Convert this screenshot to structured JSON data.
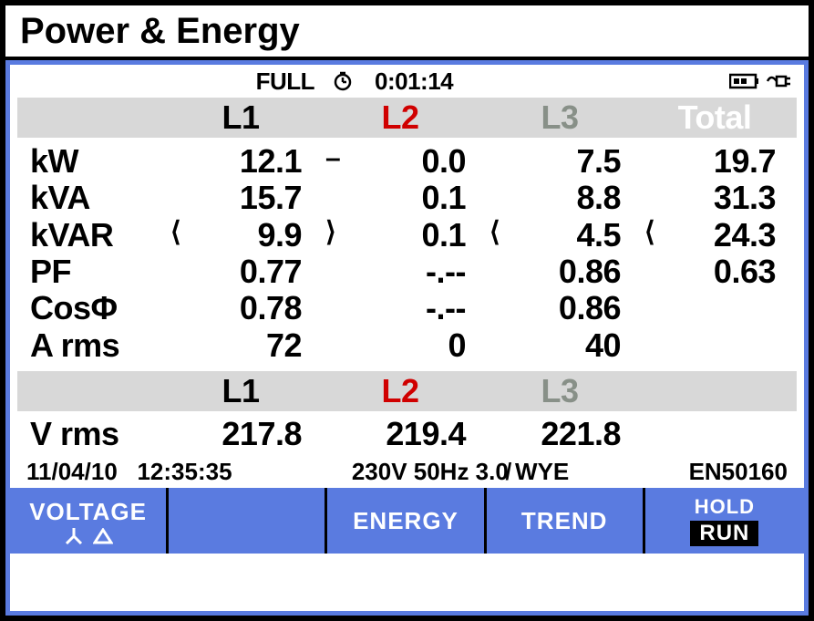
{
  "title": "Power & Energy",
  "status": {
    "mode": "FULL",
    "timer": "0:01:14"
  },
  "columns": {
    "c1": "L1",
    "c2": "L2",
    "c3": "L3",
    "c4": "Total"
  },
  "rows": {
    "kW": {
      "label": "kW",
      "L1": "12.1",
      "L1p": "",
      "L2": "0.0",
      "L2p": "–",
      "L3": "7.5",
      "L3p": "",
      "T": "19.7",
      "Tp": ""
    },
    "kVA": {
      "label": "kVA",
      "L1": "15.7",
      "L1p": "",
      "L2": "0.1",
      "L2p": "",
      "L3": "8.8",
      "L3p": "",
      "T": "31.3",
      "Tp": ""
    },
    "kVAR": {
      "label": "kVAR",
      "L1": "9.9",
      "L1p": "⟨",
      "L2": "0.1",
      "L2p": "⟩",
      "L3": "4.5",
      "L3p": "⟨",
      "T": "24.3",
      "Tp": "⟨"
    },
    "PF": {
      "label": "PF",
      "L1": "0.77",
      "L1p": "",
      "L2": "-.--",
      "L2p": "",
      "L3": "0.86",
      "L3p": "",
      "T": "0.63",
      "Tp": ""
    },
    "Cos": {
      "label": "CosΦ",
      "L1": "0.78",
      "L1p": "",
      "L2": "-.--",
      "L2p": "",
      "L3": "0.86",
      "L3p": "",
      "T": "",
      "Tp": ""
    },
    "Arms": {
      "label": "A rms",
      "L1": "72",
      "L1p": "",
      "L2": "0",
      "L2p": "",
      "L3": "40",
      "L3p": "",
      "T": "",
      "Tp": ""
    }
  },
  "columns2": {
    "c1": "L1",
    "c2": "L2",
    "c3": "L3"
  },
  "vrms": {
    "label": "V rms",
    "L1": "217.8",
    "L2": "219.4",
    "L3": "221.8"
  },
  "footer": {
    "date": "11/04/10",
    "time": "12:35:35",
    "conf": "230V  50Hz 3.0̸ WYE",
    "std": "EN50160"
  },
  "softkeys": {
    "f1": "VOLTAGE",
    "f2": "",
    "f3": "ENERGY",
    "f4": "TREND",
    "f5a": "HOLD",
    "f5b": "RUN"
  }
}
